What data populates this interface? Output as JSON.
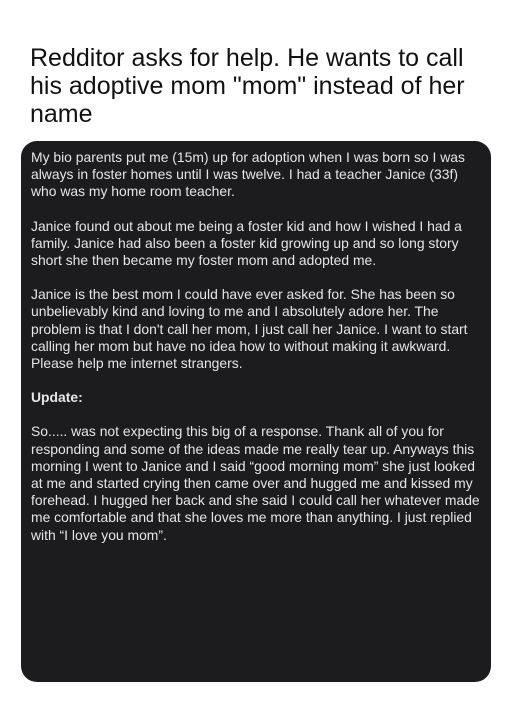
{
  "headline": "Redditor asks for help. He wants to call his adoptive mom \"mom\" instead of her name",
  "post": {
    "paragraphs": [
      "My bio parents put me (15m) up for adoption when I was born so I was always in foster homes until I was twelve. I had a teacher Janice (33f) who was my home room teacher.",
      "Janice found out about me being a foster kid and how I wished I had a family. Janice had also been a foster kid growing up and so long story short she then became my foster mom and adopted me.",
      "Janice is the best mom I could have ever asked for. She has been so unbelievably kind and loving to me and I absolutely adore her. The problem is that I don't call her mom, I just call her Janice. I want to start calling her mom but have no idea how to without making it awkward. Please help me internet strangers."
    ],
    "update_label": "Update:",
    "update_text": "So..... was not expecting this big of a response. Thank all of you for responding and some of the ideas made me really tear up. Anyways this morning I went to Janice and I said “good morning mom” she just looked at me and started crying then came over and hugged me and kissed my forehead. I hugged her back and she said I could call her whatever made me comfortable and that she loves me more than anything. I just replied with “I love you mom”."
  }
}
